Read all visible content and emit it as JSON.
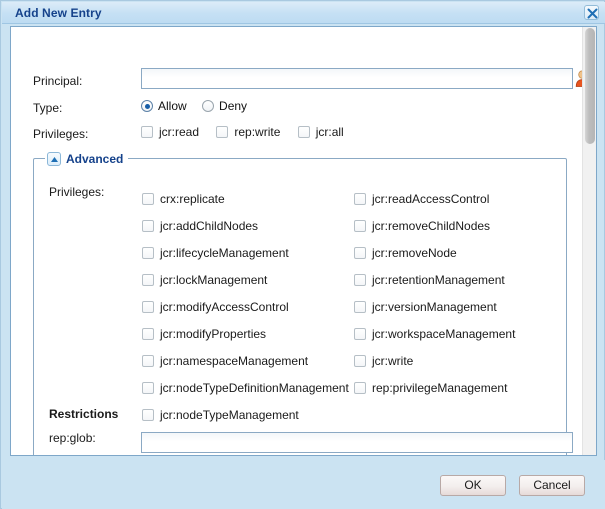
{
  "window": {
    "title": "Add New Entry",
    "close_icon": "close-icon"
  },
  "form": {
    "principal": {
      "label": "Principal:",
      "value": "",
      "placeholder": "",
      "picker_icon": "person-icon"
    },
    "type": {
      "label": "Type:",
      "options": [
        {
          "label": "Allow",
          "selected": true
        },
        {
          "label": "Deny",
          "selected": false
        }
      ]
    },
    "privileges_top": {
      "label": "Privileges:",
      "items": [
        {
          "label": "jcr:read",
          "checked": false
        },
        {
          "label": "rep:write",
          "checked": false
        },
        {
          "label": "jcr:all",
          "checked": false
        }
      ]
    }
  },
  "advanced": {
    "legend": "Advanced",
    "toggle_icon": "chevron-up-icon",
    "expanded": true,
    "privileges_label": "Privileges:",
    "privileges_left": [
      {
        "label": "crx:replicate",
        "checked": false
      },
      {
        "label": "jcr:addChildNodes",
        "checked": false
      },
      {
        "label": "jcr:lifecycleManagement",
        "checked": false
      },
      {
        "label": "jcr:lockManagement",
        "checked": false
      },
      {
        "label": "jcr:modifyAccessControl",
        "checked": false
      },
      {
        "label": "jcr:modifyProperties",
        "checked": false
      },
      {
        "label": "jcr:namespaceManagement",
        "checked": false
      },
      {
        "label": "jcr:nodeTypeDefinitionManagement",
        "checked": false
      },
      {
        "label": "jcr:nodeTypeManagement",
        "checked": false
      }
    ],
    "privileges_right": [
      {
        "label": "jcr:readAccessControl",
        "checked": false
      },
      {
        "label": "jcr:removeChildNodes",
        "checked": false
      },
      {
        "label": "jcr:removeNode",
        "checked": false
      },
      {
        "label": "jcr:retentionManagement",
        "checked": false
      },
      {
        "label": "jcr:versionManagement",
        "checked": false
      },
      {
        "label": "jcr:workspaceManagement",
        "checked": false
      },
      {
        "label": "jcr:write",
        "checked": false
      },
      {
        "label": "rep:privilegeManagement",
        "checked": false
      }
    ],
    "restrictions": {
      "title": "Restrictions",
      "rep_glob_label": "rep:glob:",
      "rep_glob_value": "",
      "rep_glob_placeholder": ""
    }
  },
  "footer": {
    "ok_label": "OK",
    "cancel_label": "Cancel"
  },
  "colors": {
    "title_text": "#15428b",
    "chrome": "#cbe3f2",
    "accent": "#175ea8",
    "field_border": "#8ba9c4"
  }
}
